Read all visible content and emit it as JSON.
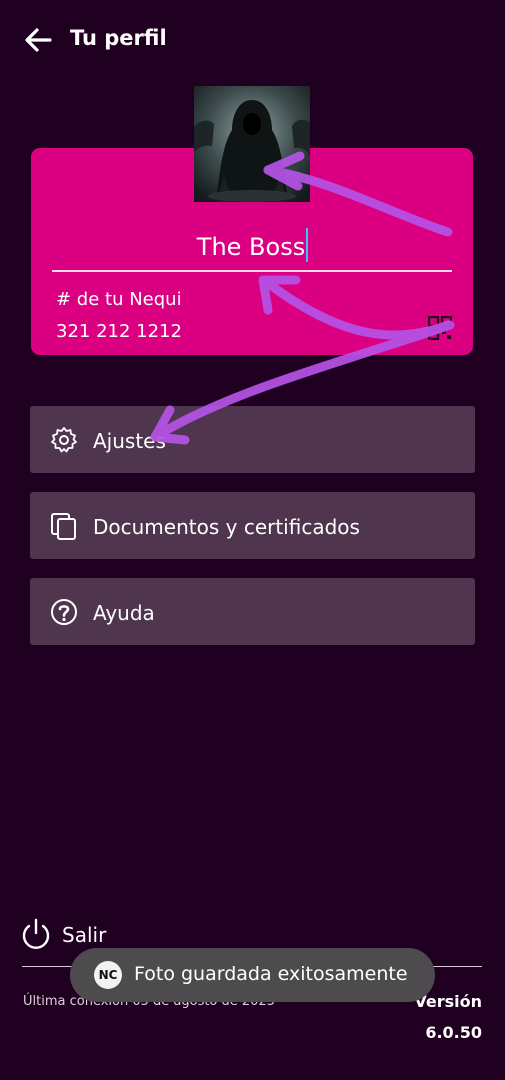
{
  "header": {
    "back_icon": "arrow-left-icon",
    "title": "Tu perfil"
  },
  "profile": {
    "avatar_icon": "hooded-figure-photo",
    "name_value": "The Boss",
    "nequi_label": "# de tu Nequi",
    "nequi_number": "321 212 1212",
    "qr_icon": "qr-code-icon",
    "card_color": "#DA0081"
  },
  "menu": {
    "items": [
      {
        "label": "Ajustes",
        "icon": "gear-icon"
      },
      {
        "label": "Documentos y certificados",
        "icon": "documents-icon"
      },
      {
        "label": "Ayuda",
        "icon": "help-icon"
      }
    ]
  },
  "footer": {
    "logout_label": "Salir",
    "logout_icon": "power-icon",
    "last_connection": "Última conexión 05 de agosto de 2025",
    "version_label": "Versión",
    "version_number": "6.0.50"
  },
  "toast": {
    "message": "Foto guardada exitosamente",
    "app_icon_text": "NC"
  },
  "colors": {
    "background": "#200020",
    "menu_item": "#4F364E",
    "annotation": "#B653E8"
  }
}
